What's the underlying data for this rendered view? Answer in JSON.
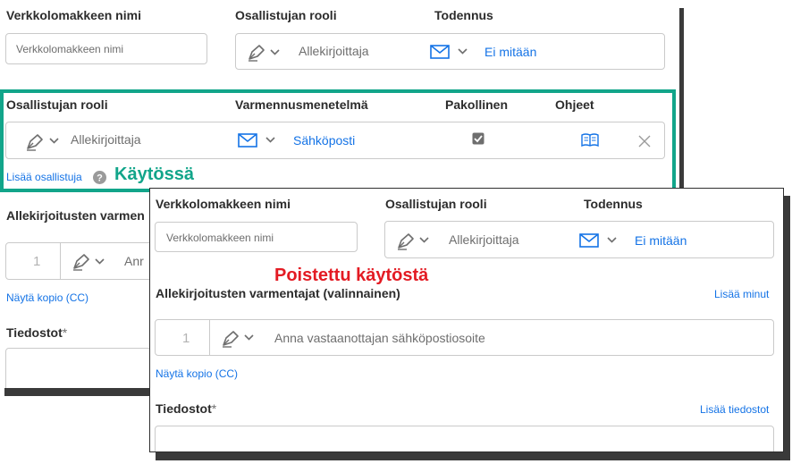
{
  "back": {
    "form_name_label": "Verkkolomakkeen nimi",
    "form_name_placeholder": "Verkkolomakkeen nimi",
    "participant_role_label": "Osallistujan rooli",
    "role_value": "Allekirjoittaja",
    "auth_label": "Todennus",
    "auth_value": "Ei mitään",
    "row": {
      "role_label": "Osallistujan rooli",
      "verification_label": "Varmennusmenetelmä",
      "required_label": "Pakollinen",
      "instructions_label": "Ohjeet",
      "role_value": "Allekirjoittaja",
      "verification_value": "Sähköposti"
    },
    "add_participant": "Lisää osallistuja",
    "enabled_caption": "Käytössä",
    "signature_verifiers_label": "Allekirjoitusten varmen",
    "number": "1",
    "email_partial": "Anr",
    "show_cc": "Näytä kopio (CC)",
    "files_label": "Tiedostot",
    "required_mark": "*"
  },
  "front": {
    "form_name_label": "Verkkolomakkeen nimi",
    "form_name_placeholder": "Verkkolomakkeen nimi",
    "participant_role_label": "Osallistujan rooli",
    "role_value": "Allekirjoittaja",
    "auth_label": "Todennus",
    "auth_value": "Ei mitään",
    "disabled_caption": "Poistettu käytöstä",
    "signature_verifiers_label": "Allekirjoitusten varmentajat (valinnainen)",
    "add_me": "Lisää minut",
    "number": "1",
    "email_placeholder": "Anna vastaanottajan sähköpostiosoite",
    "show_cc": "Näytä kopio (CC)",
    "files_label": "Tiedostot",
    "required_mark": "*",
    "add_files": "Lisää tiedostot"
  },
  "colors": {
    "highlight": "#12a58a",
    "disabled_caption": "#e31b23",
    "link": "#1473e6"
  },
  "icons": [
    "pen-icon",
    "chevron-down-icon",
    "mail-icon",
    "checkbox-icon",
    "book-icon",
    "close-icon",
    "help-icon"
  ]
}
